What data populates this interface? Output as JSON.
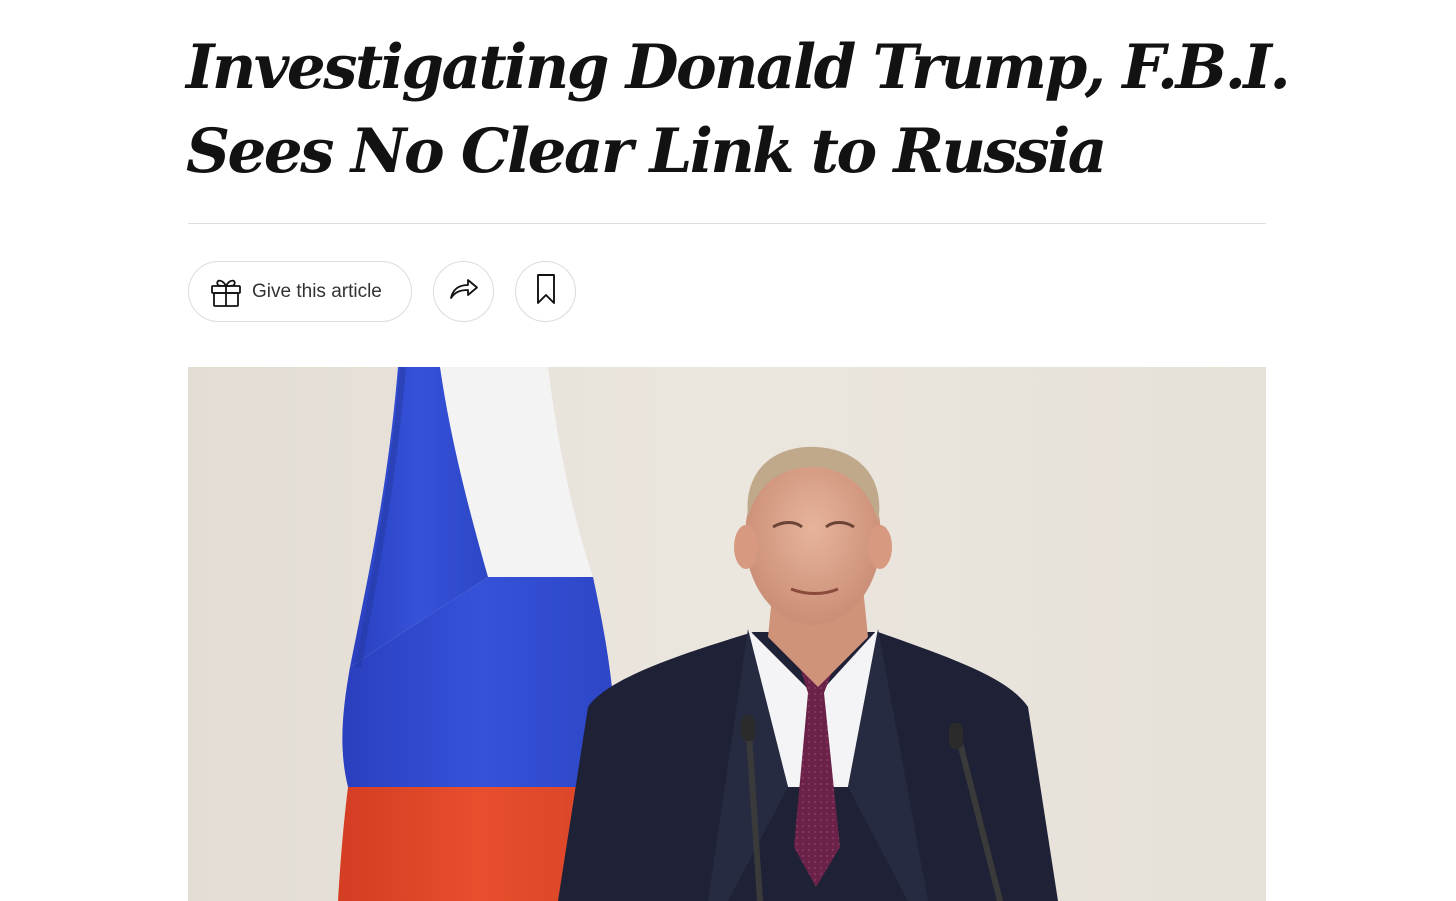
{
  "article": {
    "headline_lines": [
      "Investigating Donald Trump, F.B.I.",
      "Sees No Clear Link to Russia"
    ]
  },
  "toolbar": {
    "gift_label": "Give this article",
    "gift_icon": "gift-icon",
    "share_icon": "share-arrow-icon",
    "save_icon": "bookmark-icon"
  },
  "photo": {
    "subject": "lead-photo",
    "colors": {
      "background": "#e9e4dc",
      "flag_white": "#f1f1f1",
      "flag_blue": "#2f48cf",
      "flag_red": "#e2452a",
      "suit": "#1f2236",
      "tie": "#6a2248"
    }
  }
}
